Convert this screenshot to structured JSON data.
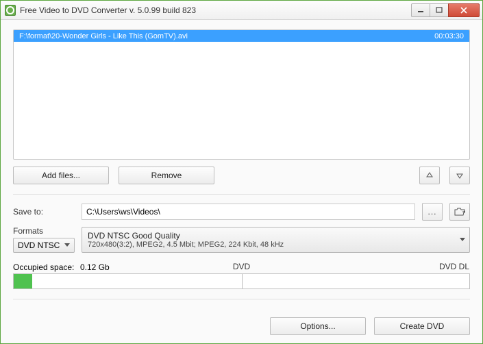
{
  "window_title": "Free Video to DVD Converter  v. 5.0.99 build 823",
  "file": {
    "path": "F:\\format\\20-Wonder Girls - Like This (GomTV).avi",
    "duration": "00:03:30"
  },
  "buttons": {
    "add_files": "Add files...",
    "remove": "Remove"
  },
  "save_to_label": "Save to:",
  "save_to_value": "C:\\Users\\ws\\Videos\\",
  "formats_label": "Formats",
  "format_selected": "DVD NTSC",
  "quality": {
    "line1": "DVD NTSC Good Quality",
    "line2": "720x480(3:2), MPEG2, 4.5 Mbit; MPEG2, 224 Kbit, 48 kHz"
  },
  "occupied": {
    "label": "Occupied space:",
    "value": "0.12 Gb",
    "mark_dvd": "DVD",
    "mark_dvddl": "DVD DL"
  },
  "footer": {
    "options": "Options...",
    "create": "Create DVD"
  }
}
